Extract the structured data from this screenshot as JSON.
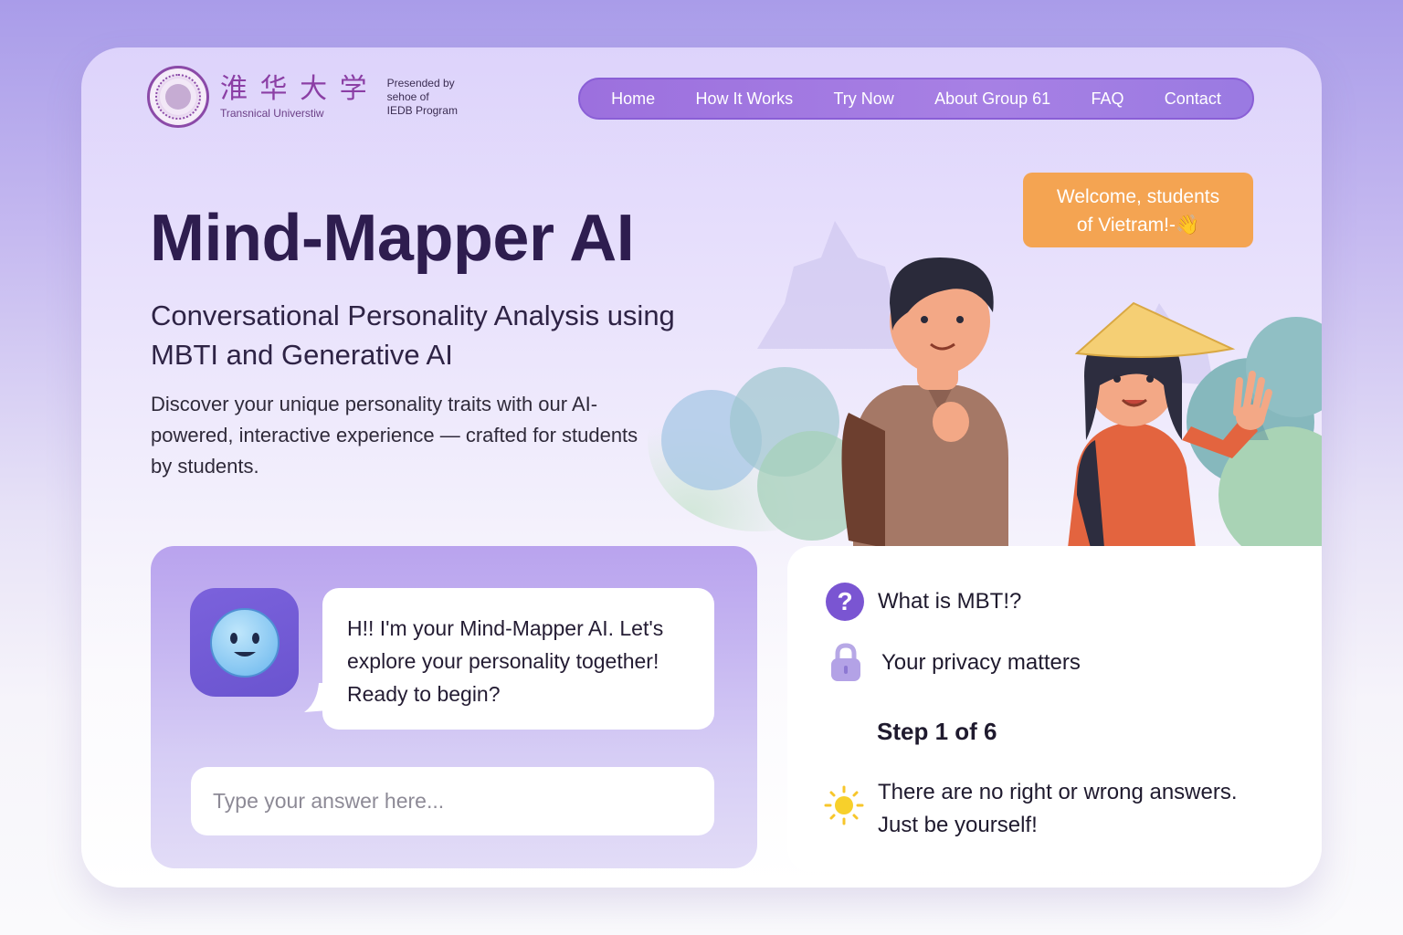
{
  "brand": {
    "logo_cn": "淮 华 大 学",
    "logo_en": "Transnical Universtiw",
    "presented_lines": [
      "Presended by",
      "sehoe of",
      "IEDB Program"
    ]
  },
  "nav": {
    "items": [
      "Home",
      "How It Works",
      "Try Now",
      "About Group 61",
      "FAQ",
      "Contact"
    ]
  },
  "hero": {
    "title": "Mind-Mapper AI",
    "subtitle": "Conversational Personality Analysis using MBTI and Generative AI",
    "description": "Discover your unique personality traits with our AI-powered, interactive experience — crafted for students by students."
  },
  "illustration": {
    "welcome_line1": "Welcome, students",
    "welcome_line2": "of Vietram!-👋"
  },
  "chat": {
    "bot_message": "H!! I'm your Mind-Mapper AI. Let's explore your personality together! Ready to begin?",
    "input_placeholder": "Type your answer here...",
    "input_value": ""
  },
  "info": {
    "mbti_label": "What is MBT!?",
    "privacy_label": "Your privacy matters",
    "step_label": "Step 1 of 6",
    "tip_line1": "There are no right or wrong answers.",
    "tip_line2": "Just be yourself!"
  },
  "colors": {
    "accent": "#7a55d2",
    "nav_bg": "#a07ae0",
    "welcome_bg": "#f4a452",
    "title": "#2e1d4f"
  },
  "icons": [
    "university-seal-icon",
    "bot-face-icon",
    "question-icon",
    "lock-icon",
    "sun-icon"
  ]
}
